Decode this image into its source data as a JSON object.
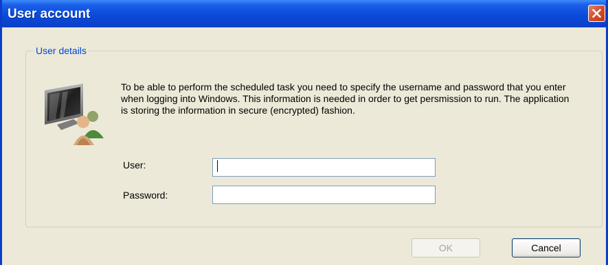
{
  "window": {
    "title": "User account"
  },
  "group": {
    "title": "User details"
  },
  "info_text": "To be able to perform the scheduled task you need to specify the username and password that you enter when logging into Windows. This information is needed in order to get persmission to run. The application is storing the information in secure (encrypted) fashion.",
  "form": {
    "user_label": "User:",
    "user_value": "",
    "password_label": "Password:",
    "password_value": ""
  },
  "buttons": {
    "ok_label": "OK",
    "cancel_label": "Cancel"
  },
  "icons": {
    "close": "close-icon",
    "user_account": "computer-users-icon"
  },
  "colors": {
    "titlebar": "#0A4BDA",
    "window_bg": "#ECE9D8",
    "group_label": "#0046D5",
    "close_button": "#D24F29"
  }
}
